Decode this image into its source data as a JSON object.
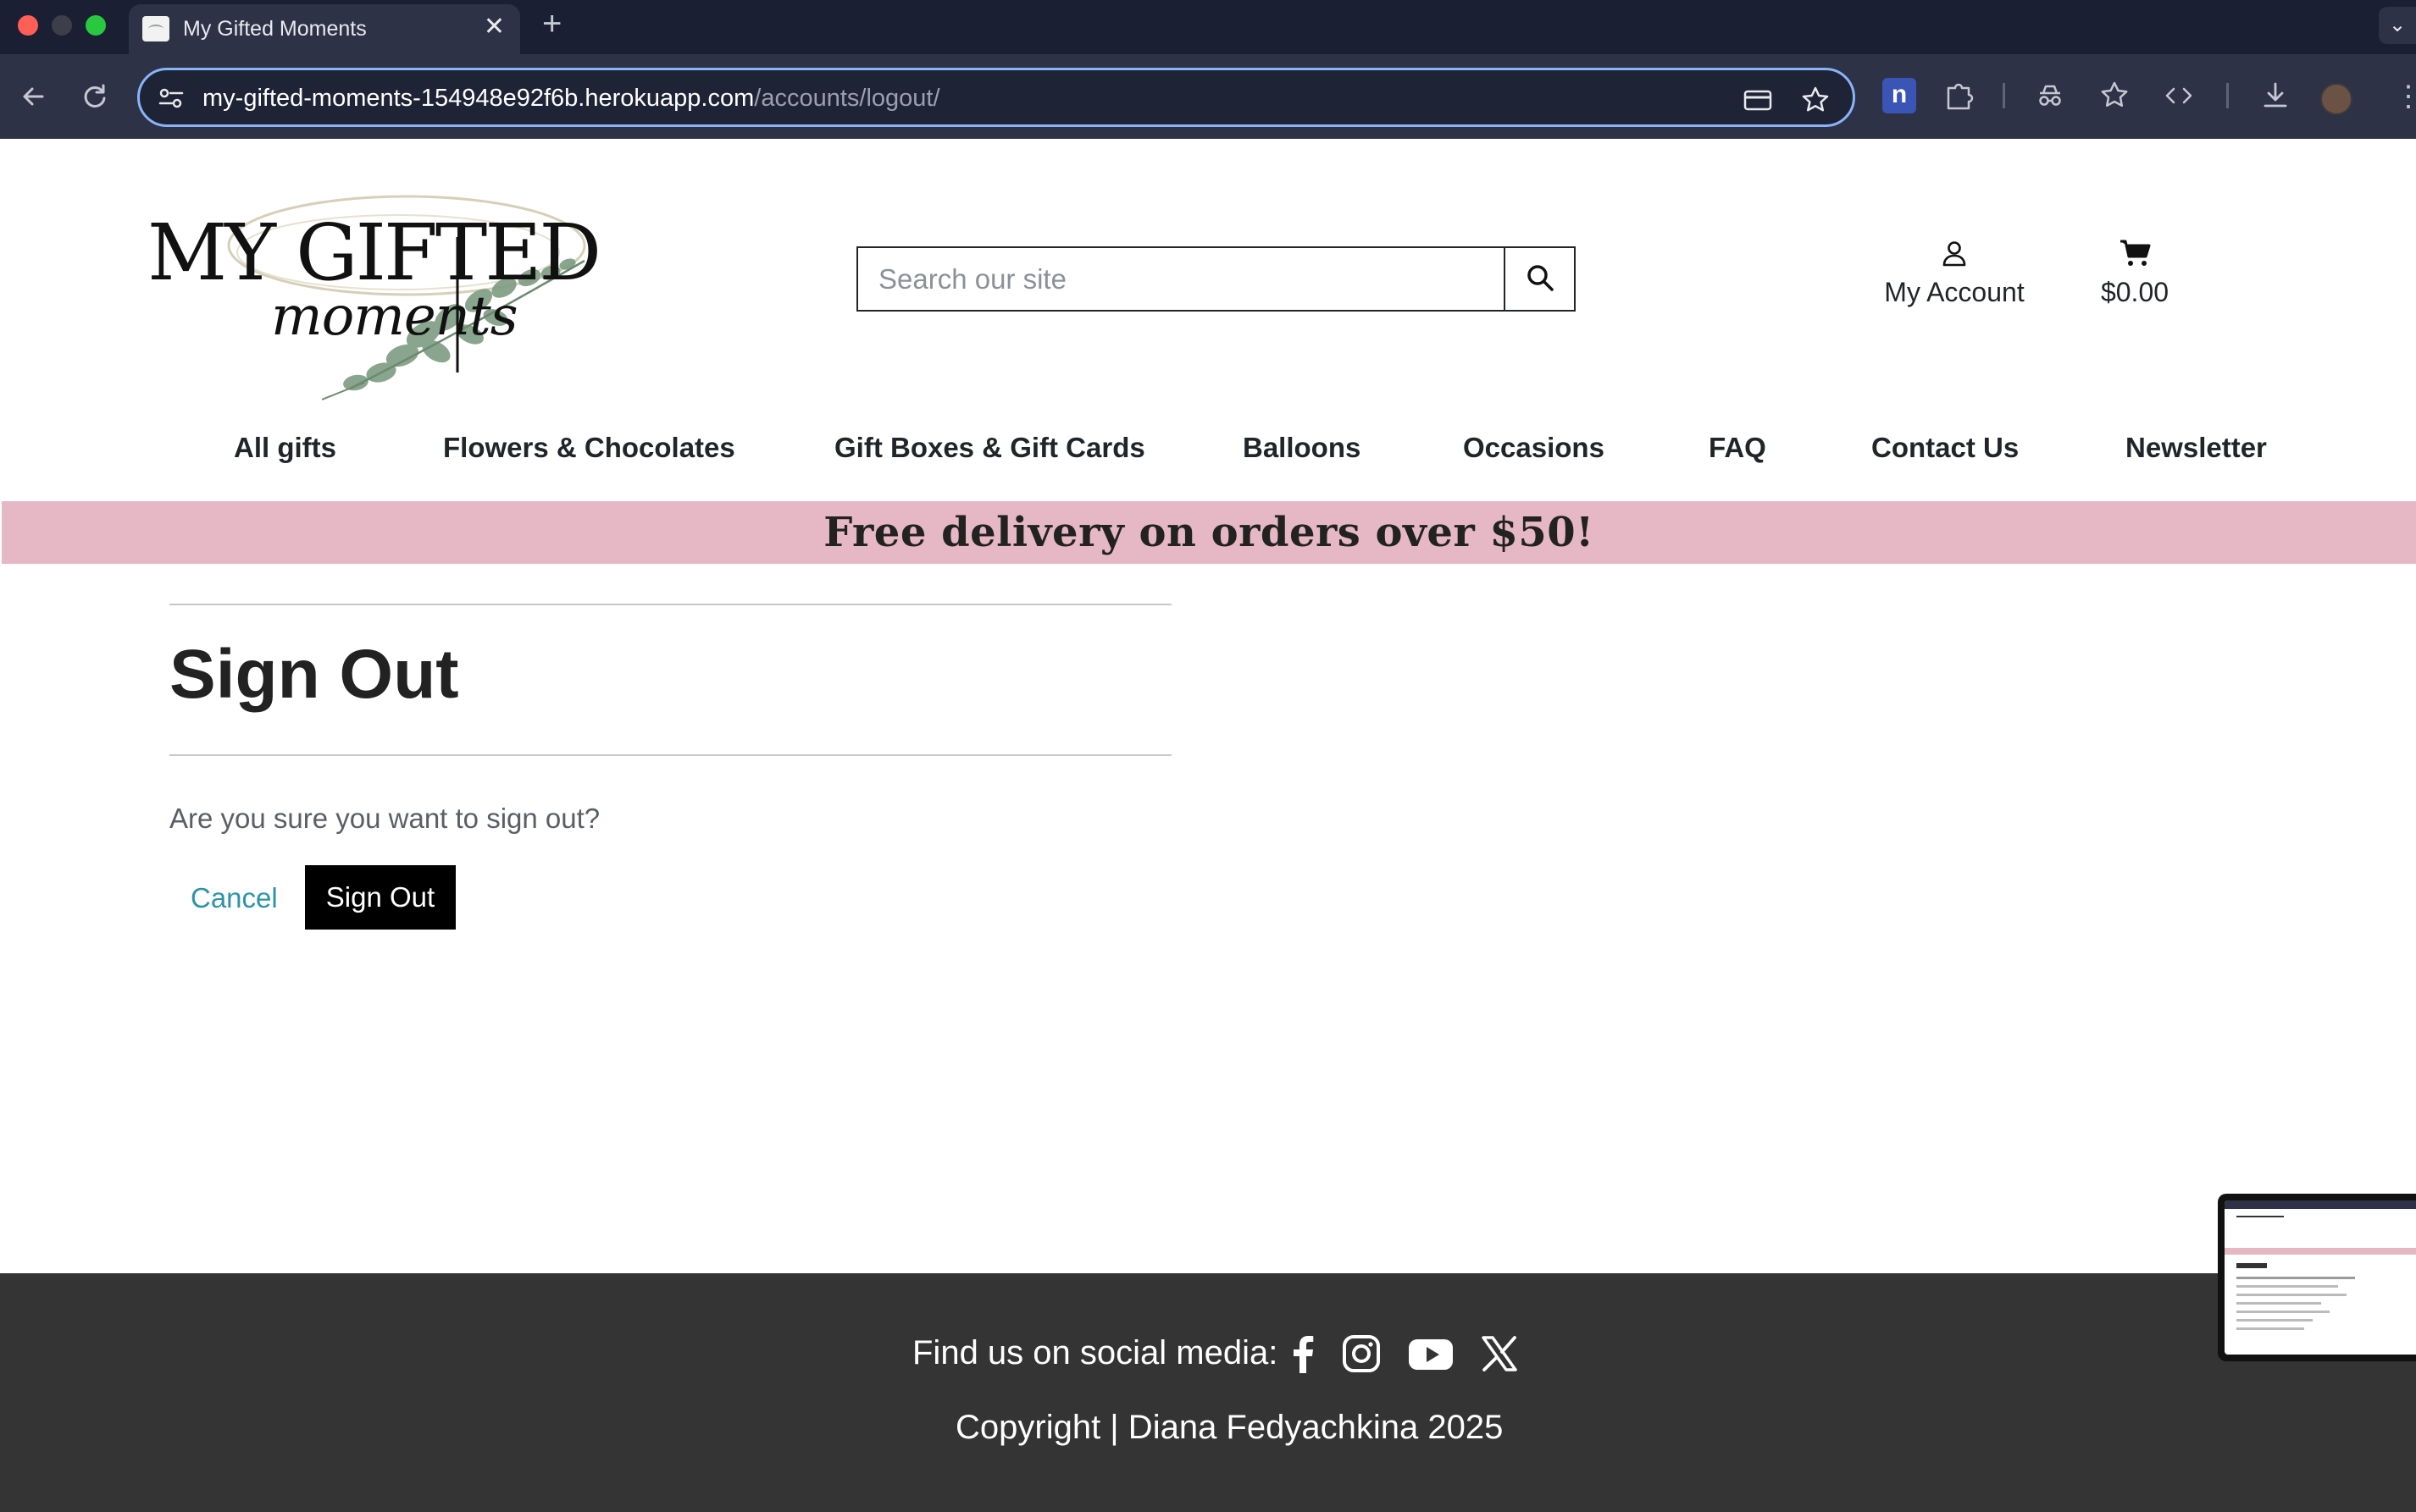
{
  "browser": {
    "tab_title": "My Gifted Moments",
    "url_host": "my-gifted-moments-154948e92f6b.herokuapp.com",
    "url_path": "/accounts/logout/",
    "extension_letter": "n"
  },
  "header": {
    "search_placeholder": "Search our site",
    "account_label": "My Account",
    "cart_total": "$0.00"
  },
  "nav": {
    "items": [
      "All gifts",
      "Flowers & Chocolates",
      "Gift Boxes & Gift Cards",
      "Balloons",
      "Occasions",
      "FAQ",
      "Contact Us",
      "Newsletter"
    ]
  },
  "banner": {
    "text": "Free delivery on orders over $50!"
  },
  "signout": {
    "title": "Sign Out",
    "question": "Are you sure you want to sign out?",
    "cancel_label": "Cancel",
    "button_label": "Sign Out"
  },
  "footer": {
    "social_label": "Find us on social media:",
    "social_icons": [
      "facebook-icon",
      "instagram-icon",
      "youtube-icon",
      "x-icon"
    ],
    "copyright": "Copyright | Diana Fedyachkina 2025"
  },
  "colors": {
    "banner_bg": "#e6b8c5",
    "footer_bg": "#343434",
    "link": "#2d93a6",
    "primary_button": "#000000"
  }
}
